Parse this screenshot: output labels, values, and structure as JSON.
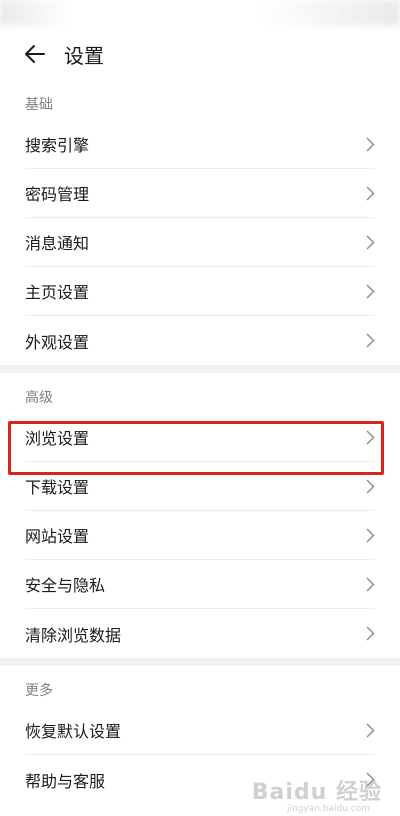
{
  "header": {
    "title": "设置",
    "back_icon": "arrow-left-icon"
  },
  "sections": [
    {
      "title": "基础",
      "items": [
        "搜索引擎",
        "密码管理",
        "消息通知",
        "主页设置",
        "外观设置"
      ]
    },
    {
      "title": "高级",
      "items": [
        "浏览设置",
        "下载设置",
        "网站设置",
        "安全与隐私",
        "清除浏览数据"
      ]
    },
    {
      "title": "更多",
      "items": [
        "恢复默认设置",
        "帮助与客服"
      ]
    }
  ],
  "highlight": {
    "item": "浏览设置",
    "color": "#d9231f"
  },
  "watermark": {
    "text": "Baidu 经验",
    "url": "jingyan.baidu.com"
  },
  "colors": {
    "background": "#ffffff",
    "divider": "#ececec",
    "section_gap": "#f2f2f2",
    "section_title": "#808080",
    "text": "#1a1a1a"
  }
}
